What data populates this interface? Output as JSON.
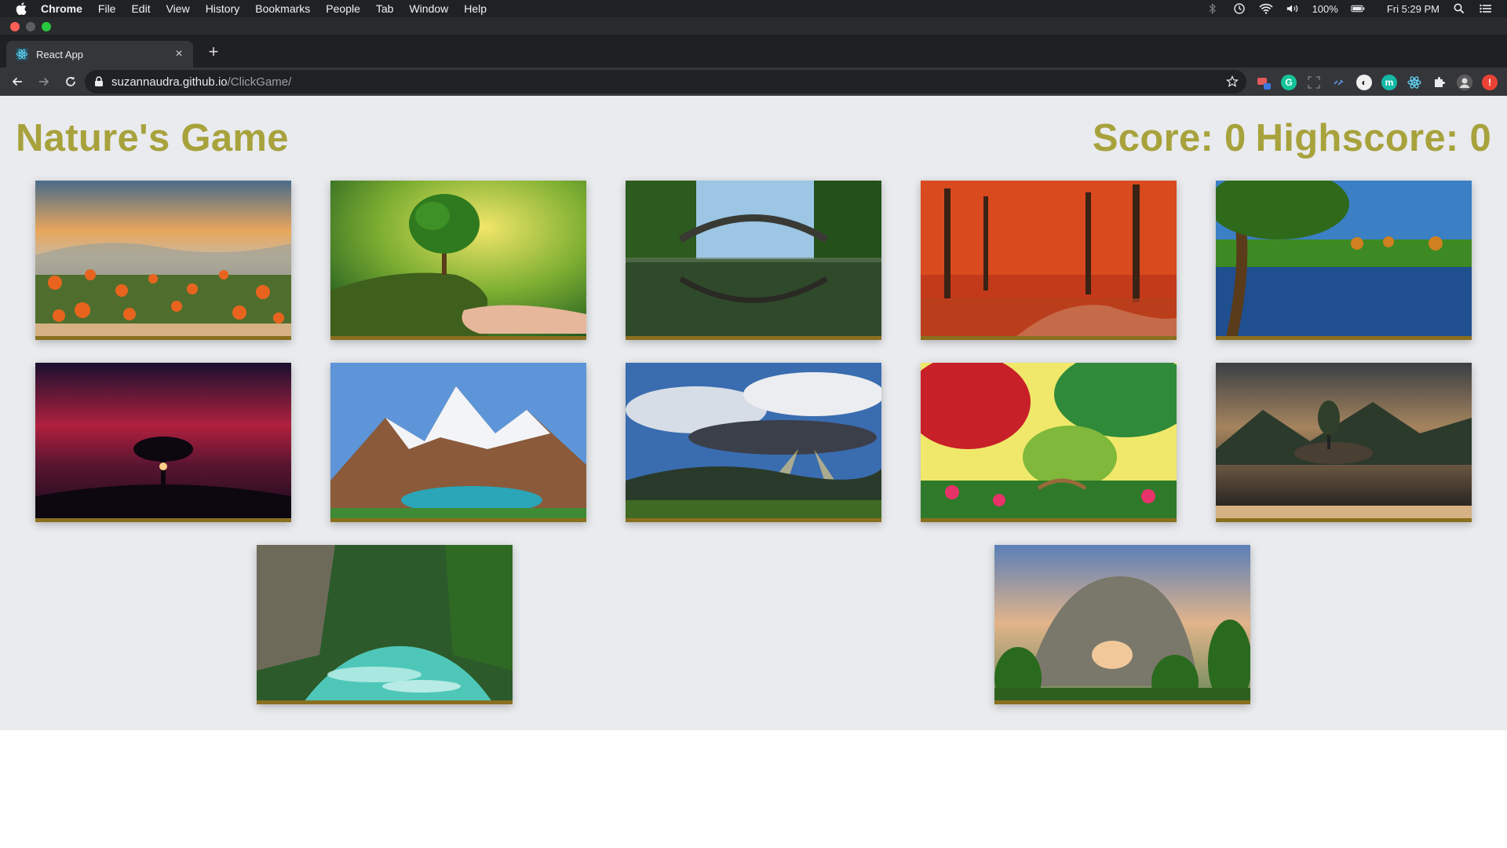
{
  "menubar": {
    "items": [
      "Chrome",
      "File",
      "Edit",
      "View",
      "History",
      "Bookmarks",
      "People",
      "Tab",
      "Window",
      "Help"
    ],
    "battery": "100%",
    "clock": "Fri 5:29 PM"
  },
  "browser": {
    "tab_title": "React App",
    "url_host": "suzannaudra.github.io",
    "url_path": "/ClickGame/"
  },
  "game": {
    "title": "Nature's Game",
    "score_label": "Score: 0",
    "highscore_label": "Highscore: 0"
  },
  "cards": [
    {
      "scene": "orange-flowers-sunrise"
    },
    {
      "scene": "tree-in-hand"
    },
    {
      "scene": "stone-arch-bridge-lake"
    },
    {
      "scene": "red-autumn-forest-path"
    },
    {
      "scene": "tree-by-pond-golf-course"
    },
    {
      "scene": "tree-silhouette-red-sky"
    },
    {
      "scene": "snowy-mountain-lake"
    },
    {
      "scene": "sunrays-clouds-valley"
    },
    {
      "scene": "colorful-garden-bridge"
    },
    {
      "scene": "rocky-island-dark-lake"
    },
    {
      "scene": "turquoise-river-canyon"
    },
    {
      "scene": "karst-arch-mountain"
    }
  ],
  "colors": {
    "title_color": "#a8a23d",
    "page_background": "#e9ebee",
    "card_border": "#8a6f20"
  }
}
